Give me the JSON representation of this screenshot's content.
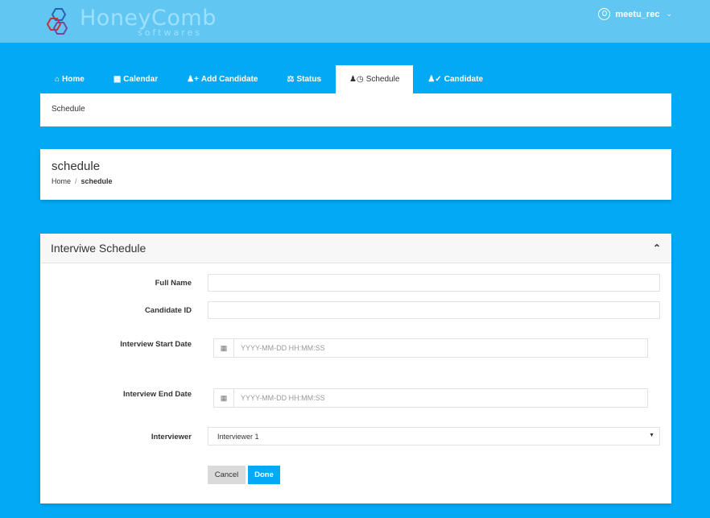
{
  "brand": {
    "name": "HoneyComb",
    "tagline": "softwares"
  },
  "user": {
    "name": "meetu_rec"
  },
  "tabs": [
    {
      "label": "Home",
      "icon": "home-icon"
    },
    {
      "label": "Calendar",
      "icon": "calendar-icon"
    },
    {
      "label": "Add Candidate",
      "icon": "user-plus-icon"
    },
    {
      "label": "Status",
      "icon": "balance-scale-icon"
    },
    {
      "label": "Schedule",
      "icon": "user-clock-icon",
      "active": true
    },
    {
      "label": "Candidate",
      "icon": "user-check-icon"
    }
  ],
  "crumb_bar": {
    "text": "Schedule"
  },
  "page_header": {
    "title": "schedule",
    "breadcrumb": {
      "home": "Home",
      "separator": "/",
      "current": "schedule"
    }
  },
  "form": {
    "title": "Interviwe Schedule",
    "full_name": {
      "label": "Full Name",
      "value": ""
    },
    "candidate_id": {
      "label": "Candidate ID",
      "value": ""
    },
    "start_date": {
      "label": "Interview Start Date",
      "placeholder": "YYYY-MM-DD HH:MM:SS"
    },
    "end_date": {
      "label": "Interview End Date",
      "placeholder": "YYYY-MM-DD HH:MM:SS"
    },
    "interviewer": {
      "label": "Interviewer",
      "selected": "Interviewer 1"
    },
    "cancel_label": "Cancel",
    "done_label": "Done"
  },
  "colors": {
    "primary": "#03a9f4",
    "topbar": "#62c6f2"
  }
}
